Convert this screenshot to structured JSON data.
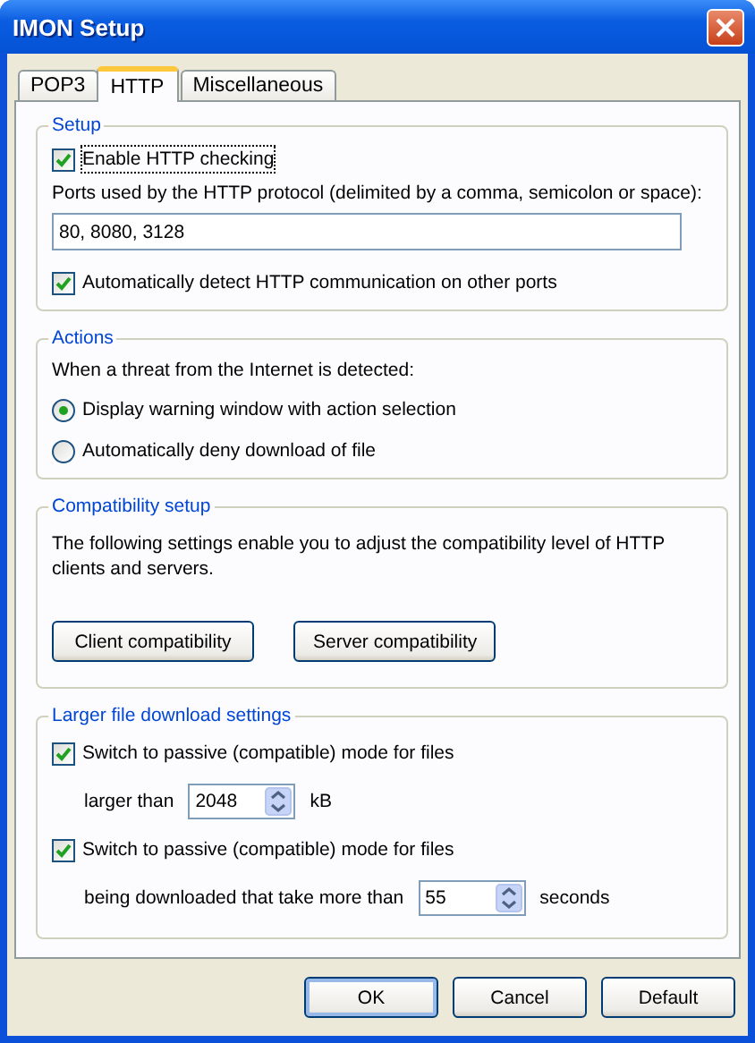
{
  "window": {
    "title": "IMON Setup"
  },
  "tabs": [
    {
      "label": "POP3",
      "selected": false
    },
    {
      "label": "HTTP",
      "selected": true
    },
    {
      "label": "Miscellaneous",
      "selected": false
    }
  ],
  "setup": {
    "legend": "Setup",
    "enable": {
      "label": "Enable HTTP checking",
      "checked": true,
      "focused": true
    },
    "ports_label": "Ports used by the HTTP protocol (delimited by a comma, semicolon or space):",
    "ports_value": "80, 8080, 3128",
    "auto_detect": {
      "label": "Automatically detect HTTP communication on other ports",
      "checked": true,
      "focused": false
    }
  },
  "actions": {
    "legend": "Actions",
    "prompt": "When a threat from the Internet is detected:",
    "options": [
      {
        "label": "Display warning window with action selection",
        "selected": true
      },
      {
        "label": "Automatically deny download of file",
        "selected": false
      }
    ]
  },
  "compatibility": {
    "legend": "Compatibility setup",
    "description": "The following settings enable you to adjust the compatibility level of HTTP clients and servers.",
    "buttons": [
      "Client compatibility",
      "Server compatibility"
    ]
  },
  "large_files": {
    "legend": "Larger file download settings",
    "rows": [
      {
        "label": "Switch to passive (compatible) mode for files",
        "checked": true,
        "prefix": "larger than",
        "value": "2048",
        "unit": "kB"
      },
      {
        "label": "Switch to passive (compatible) mode for files",
        "checked": true,
        "prefix": "being downloaded that take more than",
        "value": "55",
        "unit": "seconds"
      }
    ]
  },
  "buttons": [
    {
      "label": "OK",
      "default": true
    },
    {
      "label": "Cancel",
      "default": false
    },
    {
      "label": "Default",
      "default": false
    }
  ]
}
